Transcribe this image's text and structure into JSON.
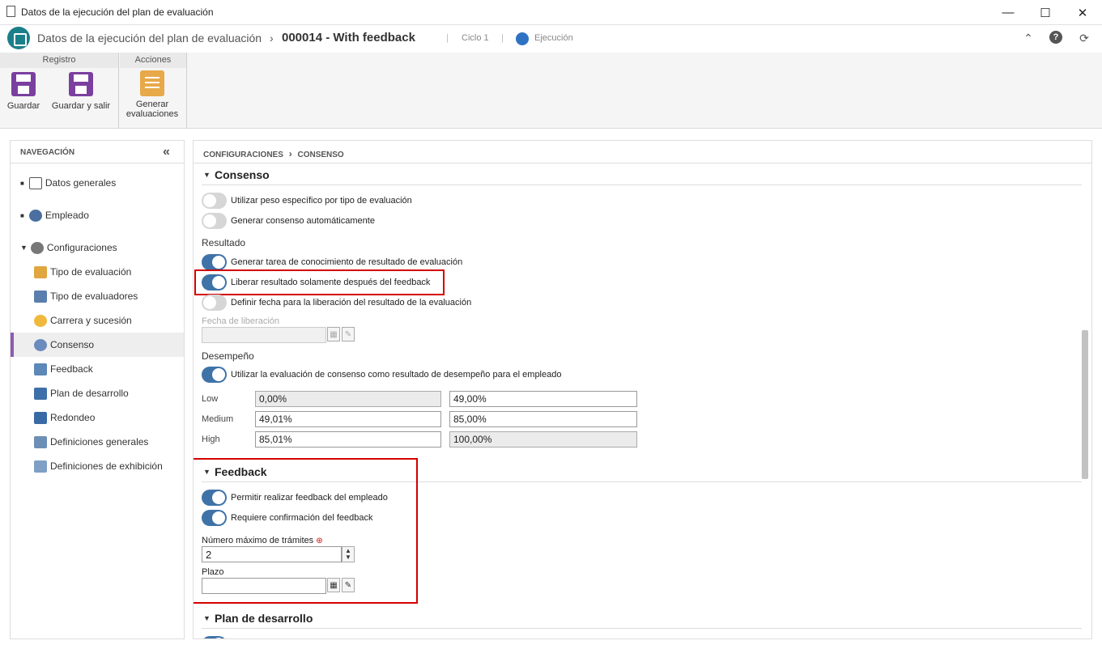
{
  "window": {
    "title": "Datos de la ejecución del plan de evaluación",
    "buttons": {
      "minimize": "—",
      "maximize": "☐",
      "close": "✕"
    }
  },
  "header": {
    "title": "Datos de la ejecución del plan de evaluación",
    "separator": "›",
    "record": "000014 - With feedback",
    "cycle": "Ciclo 1",
    "status": "Ejecución"
  },
  "ribbon": {
    "groups": {
      "registro": "Registro",
      "acciones": "Acciones"
    },
    "save": "Guardar",
    "save_exit": "Guardar y salir",
    "generate_line1": "Generar",
    "generate_line2": "evaluaciones"
  },
  "nav": {
    "header": "NAVEGACIÓN",
    "collapse": "«",
    "items": [
      {
        "label": "Datos generales"
      },
      {
        "label": "Empleado"
      },
      {
        "label": "Configuraciones"
      },
      {
        "label": "Tipo de evaluación"
      },
      {
        "label": "Tipo de evaluadores"
      },
      {
        "label": "Carrera y sucesión"
      },
      {
        "label": "Consenso"
      },
      {
        "label": "Feedback"
      },
      {
        "label": "Plan de desarrollo"
      },
      {
        "label": "Redondeo"
      },
      {
        "label": "Definiciones generales"
      },
      {
        "label": "Definiciones de exhibición"
      }
    ]
  },
  "breadcrumb": {
    "part1": "CONFIGURACIONES",
    "sep": "›",
    "part2": "CONSENSO"
  },
  "consenso": {
    "title": "Consenso",
    "toggle_peso": {
      "label": "Utilizar peso específico por tipo de evaluación",
      "on": false
    },
    "toggle_auto": {
      "label": "Generar consenso automáticamente",
      "on": false
    },
    "resultado_label": "Resultado",
    "toggle_tarea": {
      "label": "Generar tarea de conocimiento de resultado de evaluación",
      "on": true
    },
    "toggle_liberar": {
      "label": "Liberar resultado solamente después del feedback",
      "on": true
    },
    "toggle_fecha": {
      "label": "Definir fecha para la liberación del resultado de la evaluación",
      "on": false
    },
    "fecha_label": "Fecha de liberación",
    "fecha_value": "",
    "desempeno_label": "Desempeño",
    "toggle_desempeno": {
      "label": "Utilizar la evaluación de consenso como resultado de desempeño para el empleado",
      "on": true
    },
    "rows": [
      {
        "label": "Low",
        "from": "0,00%",
        "to": "49,00%"
      },
      {
        "label": "Medium",
        "from": "49,01%",
        "to": "85,00%"
      },
      {
        "label": "High",
        "from": "85,01%",
        "to": "100,00%"
      }
    ]
  },
  "feedback": {
    "title": "Feedback",
    "toggle_permitir": {
      "label": "Permitir realizar feedback del empleado",
      "on": true
    },
    "toggle_confirm": {
      "label": "Requiere confirmación del feedback",
      "on": true
    },
    "max_label": "Número máximo de trámites",
    "max_value": "2",
    "plazo_label": "Plazo",
    "plazo_value": ""
  },
  "plan": {
    "title": "Plan de desarrollo"
  },
  "colors": {
    "accent": "#3f73a8",
    "highlight": "#d40000",
    "nav_selected": "#8e5cb0"
  }
}
